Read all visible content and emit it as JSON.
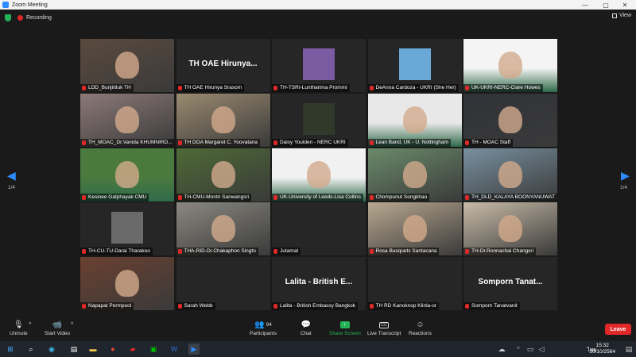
{
  "window": {
    "title": "Zoom Meeting"
  },
  "topbar": {
    "recording_label": "Recording",
    "view_label": "View"
  },
  "tiles": [
    {
      "name": "LDD_Bunjirtluk TH",
      "kind": "video",
      "bg": "#5a4a3e",
      "active": true
    },
    {
      "name": "TH OAE Hirunya Srasom",
      "kind": "name",
      "big": "TH OAE Hirunya..."
    },
    {
      "name": "TH-TSRI-Luntharima Prommi",
      "kind": "photo",
      "bg": "#7a5aa0"
    },
    {
      "name": "DeAnna Cardoza - UKRI (She Her)",
      "kind": "photo",
      "bg": "#6aa8d8"
    },
    {
      "name": "UK-UKRI-NERC-Clare Howes",
      "kind": "slide",
      "bg": "#f4f4f4"
    },
    {
      "name": "TH_MOAC_Dr.Vanida KHUMNIRD...",
      "kind": "video",
      "bg": "#8c7a78"
    },
    {
      "name": "TH DOA Margaret C. Yoovatana",
      "kind": "video",
      "bg": "#9a8a70"
    },
    {
      "name": "Daisy Youlden - NERC UKRI",
      "kind": "photo",
      "bg": "#2f3a2a"
    },
    {
      "name": "Lean Band, UK - U. Nottingham",
      "kind": "slide",
      "bg": "#e8e8e8"
    },
    {
      "name": "TH - MOAC Staff",
      "kind": "video",
      "bg": "#303238"
    },
    {
      "name": "Kesinee Gatphayak CMU",
      "kind": "slide",
      "bg": "#4a7a3e"
    },
    {
      "name": "TH-CMU-Montri Sanwangsri",
      "kind": "video",
      "bg": "#4d6a36"
    },
    {
      "name": "UK-University of Leeds-Lisa Collins",
      "kind": "slide",
      "bg": "#f1f1f1"
    },
    {
      "name": "Chompunut Songkhao",
      "kind": "video",
      "bg": "#6a8a6a"
    },
    {
      "name": "TH_DLD_KALAYA BOONYANUWAT",
      "kind": "video",
      "bg": "#7890a0"
    },
    {
      "name": "TH-CU-TU-Darai Tharakoo",
      "kind": "photo",
      "bg": "#6a6a6a"
    },
    {
      "name": "THA-RID-Dr.Chakaphon Singto",
      "kind": "video",
      "bg": "#8a8880"
    },
    {
      "name": "Jutamat",
      "kind": "blank",
      "bg": "#262626"
    },
    {
      "name": "Rosa Busquets Santacana",
      "kind": "video",
      "bg": "#b8a890"
    },
    {
      "name": "TH-Dr.Ronnachai Changsri",
      "kind": "video",
      "bg": "#c8bca8"
    },
    {
      "name": "Napapat Permpool",
      "kind": "video",
      "bg": "#6a4030"
    },
    {
      "name": "Sarah Webb",
      "kind": "photo",
      "bg": "#262626"
    },
    {
      "name": "Lalita - British Embassy Bangkok",
      "kind": "name",
      "big": "Lalita - British E..."
    },
    {
      "name": "TH RD Kanoknop Klinla-or",
      "kind": "photo",
      "bg": "#262626"
    },
    {
      "name": "Somporn Tanatvanit",
      "kind": "name",
      "big": "Somporn Tanat..."
    }
  ],
  "pagination": {
    "left": "1/4",
    "right": "1/4"
  },
  "toolbar": {
    "unmute": "Unmute",
    "start_video": "Start Video",
    "participants": "Participants",
    "participants_count": "94",
    "chat": "Chat",
    "share_screen": "Share Screen",
    "live_transcript": "Live Transcript",
    "reactions": "Reactions",
    "leave": "Leave",
    "share_color": "#24b256",
    "leave_color": "#e02828"
  },
  "taskbar": {
    "time": "15:32",
    "date": "20/10/2564",
    "language": "ไทย"
  }
}
